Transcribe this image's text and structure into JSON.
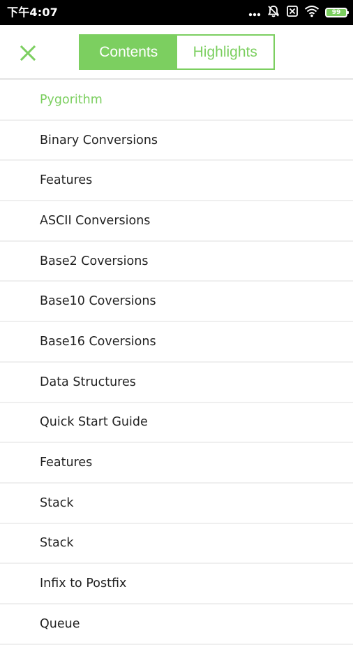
{
  "theme": {
    "accent": "#7ccf60",
    "text": "#222222"
  },
  "status_bar": {
    "time": "下午4:07",
    "icons": [
      "more-dots-icon",
      "mute-icon",
      "sim-icon",
      "wifi-icon",
      "battery-icon"
    ],
    "battery_level": "99"
  },
  "header": {
    "close_icon": "close-icon",
    "tabs": [
      {
        "label": "Contents",
        "active": true
      },
      {
        "label": "Highlights",
        "active": false
      }
    ]
  },
  "toc": {
    "items": [
      {
        "label": "Pygorithm",
        "current": true
      },
      {
        "label": "Binary Conversions",
        "current": false
      },
      {
        "label": "Features",
        "current": false
      },
      {
        "label": "ASCII Conversions",
        "current": false
      },
      {
        "label": "Base2 Coversions",
        "current": false
      },
      {
        "label": "Base10 Coversions",
        "current": false
      },
      {
        "label": "Base16 Coversions",
        "current": false
      },
      {
        "label": "Data Structures",
        "current": false
      },
      {
        "label": "Quick Start Guide",
        "current": false
      },
      {
        "label": "Features",
        "current": false
      },
      {
        "label": "Stack",
        "current": false
      },
      {
        "label": "Stack",
        "current": false
      },
      {
        "label": "Infix to Postfix",
        "current": false
      },
      {
        "label": "Queue",
        "current": false
      }
    ]
  }
}
